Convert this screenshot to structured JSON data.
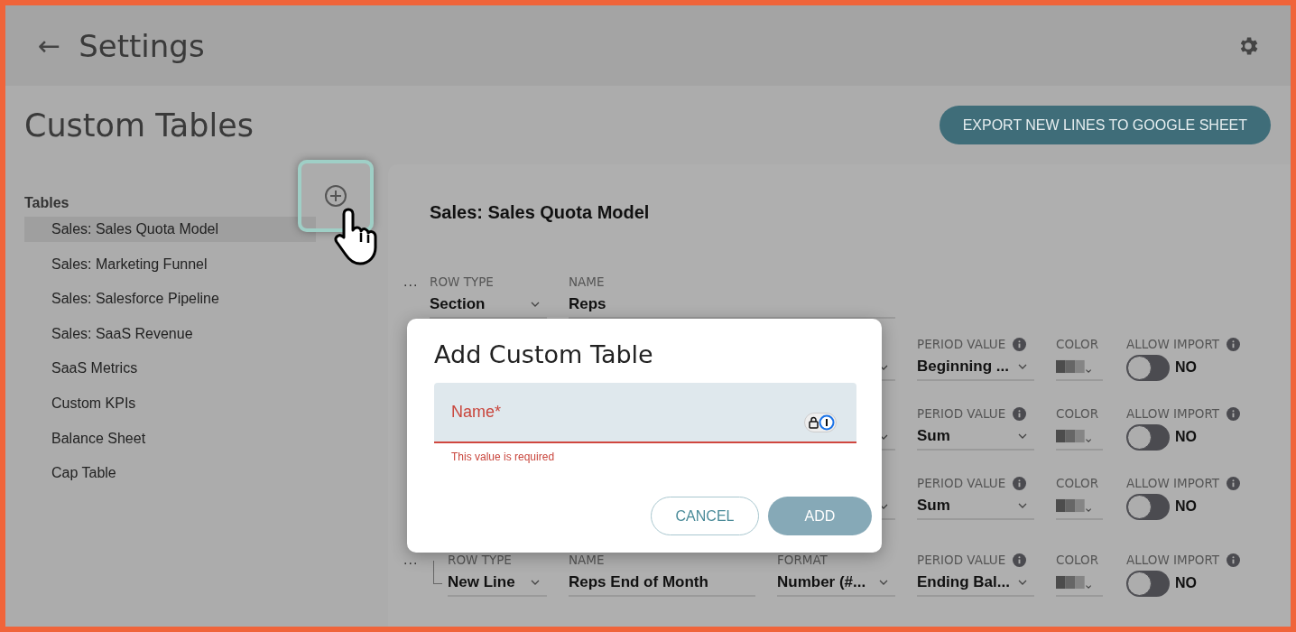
{
  "header": {
    "back": "←",
    "title": "Settings"
  },
  "page": {
    "title": "Custom Tables",
    "export_button": "EXPORT NEW LINES TO GOOGLE SHEET"
  },
  "sidebar": {
    "heading": "Tables",
    "add_highlighted": true,
    "items": [
      {
        "label": "Sales: Sales Quota Model",
        "selected": true
      },
      {
        "label": "Sales: Marketing Funnel",
        "selected": false
      },
      {
        "label": "Sales: Salesforce Pipeline",
        "selected": false
      },
      {
        "label": "Sales: SaaS Revenue",
        "selected": false
      },
      {
        "label": "SaaS Metrics",
        "selected": false
      },
      {
        "label": "Custom KPIs",
        "selected": false
      },
      {
        "label": "Balance Sheet",
        "selected": false
      },
      {
        "label": "Cap Table",
        "selected": false
      }
    ]
  },
  "table": {
    "title": "Sales: Sales Quota Model",
    "rows": [
      {
        "handle": "...",
        "row_type": {
          "label": "ROW TYPE",
          "value": "Section"
        },
        "name": {
          "label": "NAME",
          "value": "Reps"
        },
        "children": [
          {
            "period_value": {
              "label": "PERIOD VALUE",
              "value": "Beginning ..."
            },
            "color": {
              "label": "COLOR"
            },
            "allow_import": {
              "label": "ALLOW IMPORT",
              "on": false,
              "text": "NO"
            }
          },
          {
            "period_value": {
              "label": "PERIOD VALUE",
              "value": "Sum"
            },
            "color": {
              "label": "COLOR"
            },
            "allow_import": {
              "label": "ALLOW IMPORT",
              "on": false,
              "text": "NO"
            }
          },
          {
            "period_value": {
              "label": "PERIOD VALUE",
              "value": "Sum"
            },
            "color": {
              "label": "COLOR"
            },
            "allow_import": {
              "label": "ALLOW IMPORT",
              "on": false,
              "text": "NO"
            }
          },
          {
            "handle": "...",
            "row_type": {
              "label": "ROW TYPE",
              "value": "New Line"
            },
            "name": {
              "label": "NAME",
              "value": "Reps End of Month"
            },
            "format": {
              "label": "FORMAT",
              "value": "Number (#..."
            },
            "period_value": {
              "label": "PERIOD VALUE",
              "value": "Ending Bal..."
            },
            "color": {
              "label": "COLOR"
            },
            "allow_import": {
              "label": "ALLOW IMPORT",
              "on": false,
              "text": "NO"
            }
          }
        ]
      }
    ]
  },
  "dialog": {
    "title": "Add Custom Table",
    "field": {
      "label": "Name*",
      "invalid": true,
      "error": "This value is required"
    },
    "buttons": [
      {
        "label": "CANCEL",
        "kind": "secondary",
        "disabled": false
      },
      {
        "label": "ADD",
        "kind": "primary",
        "disabled": true
      }
    ]
  }
}
